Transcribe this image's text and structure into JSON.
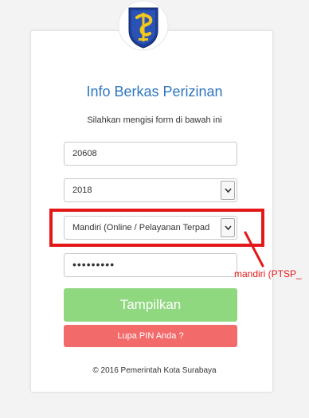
{
  "header": {
    "title": "Info Berkas Perizinan",
    "subtitle": "Silahkan mengisi form di bawah ini"
  },
  "form": {
    "registration_number": "20608",
    "year_select": "2018",
    "service_select": "Mandiri (Online / Pelayanan Terpad",
    "pin_masked": "•••••••••"
  },
  "buttons": {
    "show": "Tampilkan",
    "forgot_pin": "Lupa PIN Anda ?"
  },
  "footer": {
    "copyright": "© 2016 Pemerintah Kota Surabaya"
  },
  "annotation": {
    "text": "mandiri (PTSP_"
  },
  "colors": {
    "title": "#2f76c0",
    "show_button": "#8fd880",
    "forgot_button": "#f26a6a",
    "annotation": "#e31919"
  },
  "icons": {
    "logo": "surabaya-crest-icon",
    "select_arrow": "chevron-down-icon"
  }
}
